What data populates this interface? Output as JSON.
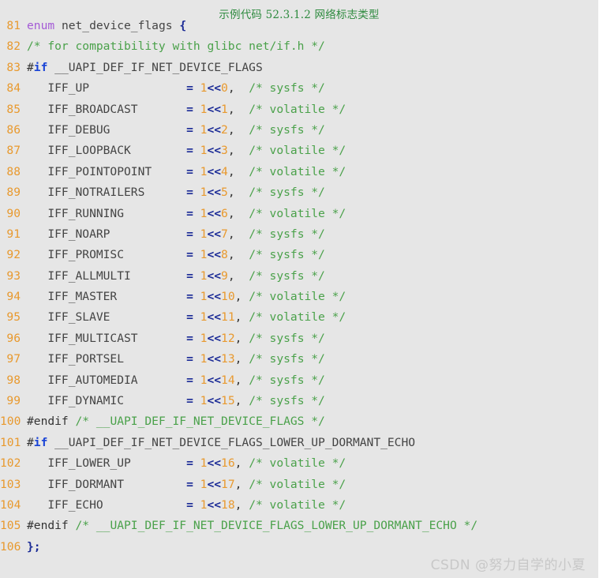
{
  "figure": {
    "caption": "示例代码 52.3.1.2 网络标志类型",
    "caption_color": "#2d8a3e",
    "background_color": "#e6e6e6",
    "language": "c"
  },
  "watermark": {
    "text": "CSDN @努力自学的小夏",
    "color": "#c8c8c8"
  },
  "theme": {
    "line_number_color": "#e8992e",
    "keyword_color": "#a45bd6",
    "preprocessor_keyword_color": "#1a44d6",
    "operator_color": "#1a2a96",
    "number_color": "#e8992e",
    "comment_color": "#4aa14a",
    "identifier_color": "#444444"
  },
  "code": {
    "first_line_number": 81,
    "last_line_number": 106,
    "lines": [
      {
        "number": "81",
        "text": "enum net_device_flags {",
        "tokens": [
          {
            "t": "enum",
            "c": "tok-kw"
          },
          {
            "t": " net_device_flags ",
            "c": "tok-ident"
          },
          {
            "t": "{",
            "c": "tok-op"
          }
        ]
      },
      {
        "number": "82",
        "text": "/* for compatibility with glibc net/if.h */",
        "tokens": [
          {
            "t": "/* for compatibility with glibc net/if.h */",
            "c": "tok-comment"
          }
        ]
      },
      {
        "number": "83",
        "text": "#if __UAPI_DEF_IF_NET_DEVICE_FLAGS",
        "tokens": [
          {
            "t": "#",
            "c": "tok-pp"
          },
          {
            "t": "if",
            "c": "tok-pp-kw"
          },
          {
            "t": " __UAPI_DEF_IF_NET_DEVICE_FLAGS",
            "c": "tok-macro"
          }
        ]
      },
      {
        "number": "84",
        "text": "   IFF_UP              = 1<<0,  /* sysfs */",
        "tokens": [
          {
            "t": "   IFF_UP             ",
            "c": "tok-ident"
          },
          {
            "t": " = ",
            "c": "tok-op"
          },
          {
            "t": "1",
            "c": "tok-num"
          },
          {
            "t": "<<",
            "c": "tok-op"
          },
          {
            "t": "0",
            "c": "tok-num"
          },
          {
            "t": ",  ",
            "c": "tok-punct"
          },
          {
            "t": "/* sysfs */",
            "c": "tok-comment"
          }
        ]
      },
      {
        "number": "85",
        "text": "   IFF_BROADCAST       = 1<<1,  /* volatile */",
        "tokens": [
          {
            "t": "   IFF_BROADCAST      ",
            "c": "tok-ident"
          },
          {
            "t": " = ",
            "c": "tok-op"
          },
          {
            "t": "1",
            "c": "tok-num"
          },
          {
            "t": "<<",
            "c": "tok-op"
          },
          {
            "t": "1",
            "c": "tok-num"
          },
          {
            "t": ",  ",
            "c": "tok-punct"
          },
          {
            "t": "/* volatile */",
            "c": "tok-comment"
          }
        ]
      },
      {
        "number": "86",
        "text": "   IFF_DEBUG           = 1<<2,  /* sysfs */",
        "tokens": [
          {
            "t": "   IFF_DEBUG          ",
            "c": "tok-ident"
          },
          {
            "t": " = ",
            "c": "tok-op"
          },
          {
            "t": "1",
            "c": "tok-num"
          },
          {
            "t": "<<",
            "c": "tok-op"
          },
          {
            "t": "2",
            "c": "tok-num"
          },
          {
            "t": ",  ",
            "c": "tok-punct"
          },
          {
            "t": "/* sysfs */",
            "c": "tok-comment"
          }
        ]
      },
      {
        "number": "87",
        "text": "   IFF_LOOPBACK        = 1<<3,  /* volatile */",
        "tokens": [
          {
            "t": "   IFF_LOOPBACK       ",
            "c": "tok-ident"
          },
          {
            "t": " = ",
            "c": "tok-op"
          },
          {
            "t": "1",
            "c": "tok-num"
          },
          {
            "t": "<<",
            "c": "tok-op"
          },
          {
            "t": "3",
            "c": "tok-num"
          },
          {
            "t": ",  ",
            "c": "tok-punct"
          },
          {
            "t": "/* volatile */",
            "c": "tok-comment"
          }
        ]
      },
      {
        "number": "88",
        "text": "   IFF_POINTOPOINT     = 1<<4,  /* volatile */",
        "tokens": [
          {
            "t": "   IFF_POINTOPOINT    ",
            "c": "tok-ident"
          },
          {
            "t": " = ",
            "c": "tok-op"
          },
          {
            "t": "1",
            "c": "tok-num"
          },
          {
            "t": "<<",
            "c": "tok-op"
          },
          {
            "t": "4",
            "c": "tok-num"
          },
          {
            "t": ",  ",
            "c": "tok-punct"
          },
          {
            "t": "/* volatile */",
            "c": "tok-comment"
          }
        ]
      },
      {
        "number": "89",
        "text": "   IFF_NOTRAILERS      = 1<<5,  /* sysfs */",
        "tokens": [
          {
            "t": "   IFF_NOTRAILERS     ",
            "c": "tok-ident"
          },
          {
            "t": " = ",
            "c": "tok-op"
          },
          {
            "t": "1",
            "c": "tok-num"
          },
          {
            "t": "<<",
            "c": "tok-op"
          },
          {
            "t": "5",
            "c": "tok-num"
          },
          {
            "t": ",  ",
            "c": "tok-punct"
          },
          {
            "t": "/* sysfs */",
            "c": "tok-comment"
          }
        ]
      },
      {
        "number": "90",
        "text": "   IFF_RUNNING         = 1<<6,  /* volatile */",
        "tokens": [
          {
            "t": "   IFF_RUNNING        ",
            "c": "tok-ident"
          },
          {
            "t": " = ",
            "c": "tok-op"
          },
          {
            "t": "1",
            "c": "tok-num"
          },
          {
            "t": "<<",
            "c": "tok-op"
          },
          {
            "t": "6",
            "c": "tok-num"
          },
          {
            "t": ",  ",
            "c": "tok-punct"
          },
          {
            "t": "/* volatile */",
            "c": "tok-comment"
          }
        ]
      },
      {
        "number": "91",
        "text": "   IFF_NOARP           = 1<<7,  /* sysfs */",
        "tokens": [
          {
            "t": "   IFF_NOARP          ",
            "c": "tok-ident"
          },
          {
            "t": " = ",
            "c": "tok-op"
          },
          {
            "t": "1",
            "c": "tok-num"
          },
          {
            "t": "<<",
            "c": "tok-op"
          },
          {
            "t": "7",
            "c": "tok-num"
          },
          {
            "t": ",  ",
            "c": "tok-punct"
          },
          {
            "t": "/* sysfs */",
            "c": "tok-comment"
          }
        ]
      },
      {
        "number": "92",
        "text": "   IFF_PROMISC         = 1<<8,  /* sysfs */",
        "tokens": [
          {
            "t": "   IFF_PROMISC        ",
            "c": "tok-ident"
          },
          {
            "t": " = ",
            "c": "tok-op"
          },
          {
            "t": "1",
            "c": "tok-num"
          },
          {
            "t": "<<",
            "c": "tok-op"
          },
          {
            "t": "8",
            "c": "tok-num"
          },
          {
            "t": ",  ",
            "c": "tok-punct"
          },
          {
            "t": "/* sysfs */",
            "c": "tok-comment"
          }
        ]
      },
      {
        "number": "93",
        "text": "   IFF_ALLMULTI        = 1<<9,  /* sysfs */",
        "tokens": [
          {
            "t": "   IFF_ALLMULTI       ",
            "c": "tok-ident"
          },
          {
            "t": " = ",
            "c": "tok-op"
          },
          {
            "t": "1",
            "c": "tok-num"
          },
          {
            "t": "<<",
            "c": "tok-op"
          },
          {
            "t": "9",
            "c": "tok-num"
          },
          {
            "t": ",  ",
            "c": "tok-punct"
          },
          {
            "t": "/* sysfs */",
            "c": "tok-comment"
          }
        ]
      },
      {
        "number": "94",
        "text": "   IFF_MASTER          = 1<<10, /* volatile */",
        "tokens": [
          {
            "t": "   IFF_MASTER         ",
            "c": "tok-ident"
          },
          {
            "t": " = ",
            "c": "tok-op"
          },
          {
            "t": "1",
            "c": "tok-num"
          },
          {
            "t": "<<",
            "c": "tok-op"
          },
          {
            "t": "10",
            "c": "tok-num"
          },
          {
            "t": ", ",
            "c": "tok-punct"
          },
          {
            "t": "/* volatile */",
            "c": "tok-comment"
          }
        ]
      },
      {
        "number": "95",
        "text": "   IFF_SLAVE           = 1<<11, /* volatile */",
        "tokens": [
          {
            "t": "   IFF_SLAVE          ",
            "c": "tok-ident"
          },
          {
            "t": " = ",
            "c": "tok-op"
          },
          {
            "t": "1",
            "c": "tok-num"
          },
          {
            "t": "<<",
            "c": "tok-op"
          },
          {
            "t": "11",
            "c": "tok-num"
          },
          {
            "t": ", ",
            "c": "tok-punct"
          },
          {
            "t": "/* volatile */",
            "c": "tok-comment"
          }
        ]
      },
      {
        "number": "96",
        "text": "   IFF_MULTICAST       = 1<<12, /* sysfs */",
        "tokens": [
          {
            "t": "   IFF_MULTICAST      ",
            "c": "tok-ident"
          },
          {
            "t": " = ",
            "c": "tok-op"
          },
          {
            "t": "1",
            "c": "tok-num"
          },
          {
            "t": "<<",
            "c": "tok-op"
          },
          {
            "t": "12",
            "c": "tok-num"
          },
          {
            "t": ", ",
            "c": "tok-punct"
          },
          {
            "t": "/* sysfs */",
            "c": "tok-comment"
          }
        ]
      },
      {
        "number": "97",
        "text": "   IFF_PORTSEL         = 1<<13, /* sysfs */",
        "tokens": [
          {
            "t": "   IFF_PORTSEL        ",
            "c": "tok-ident"
          },
          {
            "t": " = ",
            "c": "tok-op"
          },
          {
            "t": "1",
            "c": "tok-num"
          },
          {
            "t": "<<",
            "c": "tok-op"
          },
          {
            "t": "13",
            "c": "tok-num"
          },
          {
            "t": ", ",
            "c": "tok-punct"
          },
          {
            "t": "/* sysfs */",
            "c": "tok-comment"
          }
        ]
      },
      {
        "number": "98",
        "text": "   IFF_AUTOMEDIA       = 1<<14, /* sysfs */",
        "tokens": [
          {
            "t": "   IFF_AUTOMEDIA      ",
            "c": "tok-ident"
          },
          {
            "t": " = ",
            "c": "tok-op"
          },
          {
            "t": "1",
            "c": "tok-num"
          },
          {
            "t": "<<",
            "c": "tok-op"
          },
          {
            "t": "14",
            "c": "tok-num"
          },
          {
            "t": ", ",
            "c": "tok-punct"
          },
          {
            "t": "/* sysfs */",
            "c": "tok-comment"
          }
        ]
      },
      {
        "number": "99",
        "text": "   IFF_DYNAMIC         = 1<<15, /* sysfs */",
        "tokens": [
          {
            "t": "   IFF_DYNAMIC        ",
            "c": "tok-ident"
          },
          {
            "t": " = ",
            "c": "tok-op"
          },
          {
            "t": "1",
            "c": "tok-num"
          },
          {
            "t": "<<",
            "c": "tok-op"
          },
          {
            "t": "15",
            "c": "tok-num"
          },
          {
            "t": ", ",
            "c": "tok-punct"
          },
          {
            "t": "/* sysfs */",
            "c": "tok-comment"
          }
        ]
      },
      {
        "number": "100",
        "text": "#endif /* __UAPI_DEF_IF_NET_DEVICE_FLAGS */",
        "tokens": [
          {
            "t": "#endif ",
            "c": "tok-pp"
          },
          {
            "t": "/* __UAPI_DEF_IF_NET_DEVICE_FLAGS */",
            "c": "tok-comment"
          }
        ]
      },
      {
        "number": "101",
        "text": "#if __UAPI_DEF_IF_NET_DEVICE_FLAGS_LOWER_UP_DORMANT_ECHO",
        "tokens": [
          {
            "t": "#",
            "c": "tok-pp"
          },
          {
            "t": "if",
            "c": "tok-pp-kw"
          },
          {
            "t": " __UAPI_DEF_IF_NET_DEVICE_FLAGS_LOWER_UP_DORMANT_ECHO",
            "c": "tok-macro"
          }
        ]
      },
      {
        "number": "102",
        "text": "   IFF_LOWER_UP        = 1<<16, /* volatile */",
        "tokens": [
          {
            "t": "   IFF_LOWER_UP       ",
            "c": "tok-ident"
          },
          {
            "t": " = ",
            "c": "tok-op"
          },
          {
            "t": "1",
            "c": "tok-num"
          },
          {
            "t": "<<",
            "c": "tok-op"
          },
          {
            "t": "16",
            "c": "tok-num"
          },
          {
            "t": ", ",
            "c": "tok-punct"
          },
          {
            "t": "/* volatile */",
            "c": "tok-comment"
          }
        ]
      },
      {
        "number": "103",
        "text": "   IFF_DORMANT         = 1<<17, /* volatile */",
        "tokens": [
          {
            "t": "   IFF_DORMANT        ",
            "c": "tok-ident"
          },
          {
            "t": " = ",
            "c": "tok-op"
          },
          {
            "t": "1",
            "c": "tok-num"
          },
          {
            "t": "<<",
            "c": "tok-op"
          },
          {
            "t": "17",
            "c": "tok-num"
          },
          {
            "t": ", ",
            "c": "tok-punct"
          },
          {
            "t": "/* volatile */",
            "c": "tok-comment"
          }
        ]
      },
      {
        "number": "104",
        "text": "   IFF_ECHO            = 1<<18, /* volatile */",
        "tokens": [
          {
            "t": "   IFF_ECHO           ",
            "c": "tok-ident"
          },
          {
            "t": " = ",
            "c": "tok-op"
          },
          {
            "t": "1",
            "c": "tok-num"
          },
          {
            "t": "<<",
            "c": "tok-op"
          },
          {
            "t": "18",
            "c": "tok-num"
          },
          {
            "t": ", ",
            "c": "tok-punct"
          },
          {
            "t": "/* volatile */",
            "c": "tok-comment"
          }
        ]
      },
      {
        "number": "105",
        "text": "#endif /* __UAPI_DEF_IF_NET_DEVICE_FLAGS_LOWER_UP_DORMANT_ECHO */",
        "tokens": [
          {
            "t": "#endif ",
            "c": "tok-pp"
          },
          {
            "t": "/* __UAPI_DEF_IF_NET_DEVICE_FLAGS_LOWER_UP_DORMANT_ECHO */",
            "c": "tok-comment"
          }
        ]
      },
      {
        "number": "106",
        "text": "};",
        "tokens": [
          {
            "t": "};",
            "c": "tok-op"
          }
        ]
      }
    ]
  }
}
